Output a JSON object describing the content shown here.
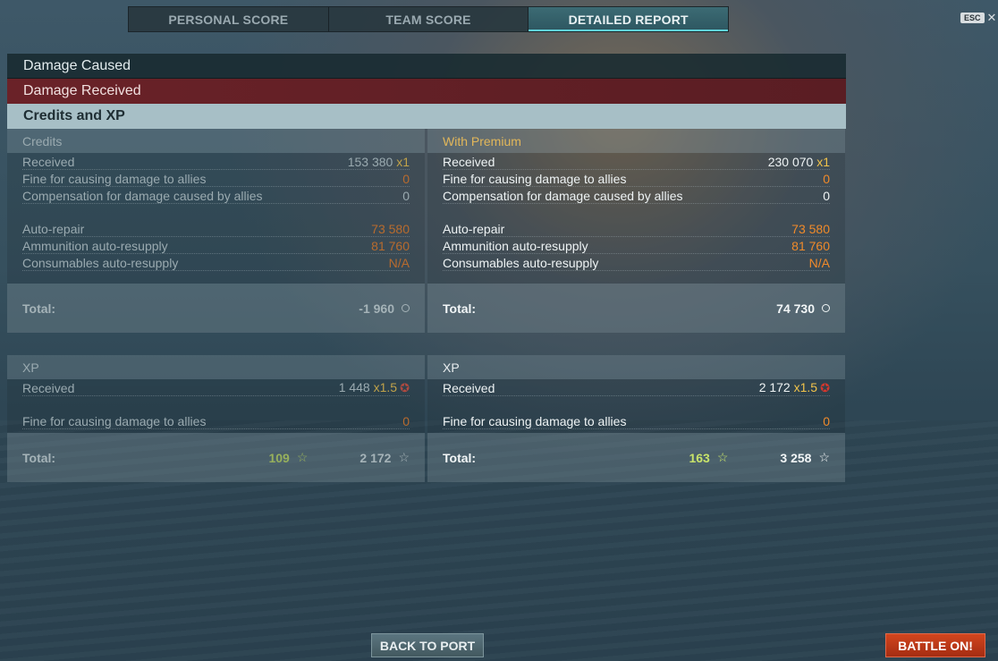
{
  "tabs": [
    {
      "label": "PERSONAL SCORE"
    },
    {
      "label": "TEAM SCORE"
    },
    {
      "label": "DETAILED REPORT",
      "active": true
    }
  ],
  "esc": {
    "key": "ESC",
    "close": "✕"
  },
  "sections": {
    "damage_caused": "Damage Caused",
    "damage_received": "Damage Received",
    "credits_xp": "Credits and XP"
  },
  "credits": {
    "left": {
      "title": "Credits",
      "received_label": "Received",
      "received_value": "153 380",
      "received_mult": "x1",
      "fine_label": "Fine for causing damage to allies",
      "fine_value": "0",
      "comp_label": "Compensation for damage caused by allies",
      "comp_value": "0",
      "repair_label": "Auto-repair",
      "repair_value": "73 580",
      "ammo_label": "Ammunition auto-resupply",
      "ammo_value": "81 760",
      "consumables_label": "Consumables auto-resupply",
      "consumables_value": "N/A",
      "total_label": "Total:",
      "total_value": "-1 960"
    },
    "right": {
      "title": "With Premium",
      "received_label": "Received",
      "received_value": "230 070",
      "received_mult": "x1",
      "fine_label": "Fine for causing damage to allies",
      "fine_value": "0",
      "comp_label": "Compensation for damage caused by allies",
      "comp_value": "0",
      "repair_label": "Auto-repair",
      "repair_value": "73 580",
      "ammo_label": "Ammunition auto-resupply",
      "ammo_value": "81 760",
      "consumables_label": "Consumables auto-resupply",
      "consumables_value": "N/A",
      "total_label": "Total:",
      "total_value": "74 730"
    }
  },
  "xp": {
    "left": {
      "title": "XP",
      "received_label": "Received",
      "received_value": "1 448",
      "received_mult": "x1.5",
      "fine_label": "Fine for causing damage to allies",
      "fine_value": "0",
      "total_label": "Total:",
      "total_green": "109",
      "total_value": "2 172"
    },
    "right": {
      "title": "XP",
      "received_label": "Received",
      "received_value": "2 172",
      "received_mult": "x1.5",
      "fine_label": "Fine for causing damage to allies",
      "fine_value": "0",
      "total_label": "Total:",
      "total_green": "163",
      "total_value": "3 258"
    }
  },
  "buttons": {
    "back_to_port": "BACK TO PORT",
    "battle_on": "BATTLE ON!"
  }
}
